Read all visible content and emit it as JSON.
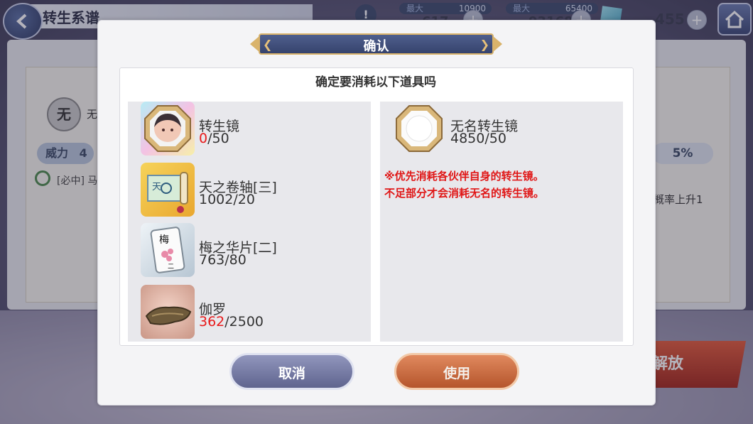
{
  "background": {
    "screen_title": "转生系谱",
    "resource1": {
      "max_label": "最大",
      "max": "10900",
      "value": "617"
    },
    "resource2": {
      "max_label": "最大",
      "max": "65400",
      "value": "93168"
    },
    "resource3": {
      "value": "455"
    },
    "wu_badge": "无",
    "wu_text": "无",
    "power_label": "威力",
    "power_value": "4",
    "percent": "5%",
    "bizhong_text": "[必中] 马",
    "desc_right": "概率上升1",
    "release_label": "解放"
  },
  "dialog": {
    "title": "确认",
    "question": "确定要消耗以下道具吗",
    "left_items": [
      {
        "name": "转生镜",
        "have": "0",
        "need": "/50",
        "have_red": true,
        "icon": "mirror-portrait-icon"
      },
      {
        "name": "天之卷轴[三]",
        "have": "1002",
        "need": "/20",
        "have_red": false,
        "icon": "scroll-icon"
      },
      {
        "name": "梅之华片[二]",
        "have": "763",
        "need": "/80",
        "have_red": false,
        "icon": "plum-tile-icon"
      },
      {
        "name": "伽罗",
        "have": "362",
        "need": "/2500",
        "have_red": true,
        "icon": "agarwood-icon"
      }
    ],
    "right_item": {
      "name": "无名转生镜",
      "count": "4850/50",
      "icon": "blank-mirror-icon"
    },
    "note_line1": "※优先消耗各伙伴自身的转生镜。",
    "note_line2": "不足部分才会消耗无名的转生镜。",
    "cancel_label": "取消",
    "use_label": "使用"
  },
  "colors": {
    "accent_red": "#e8191a",
    "banner": "#3f4c78",
    "cancel": "#7a7fa8",
    "use": "#c96a3f"
  }
}
